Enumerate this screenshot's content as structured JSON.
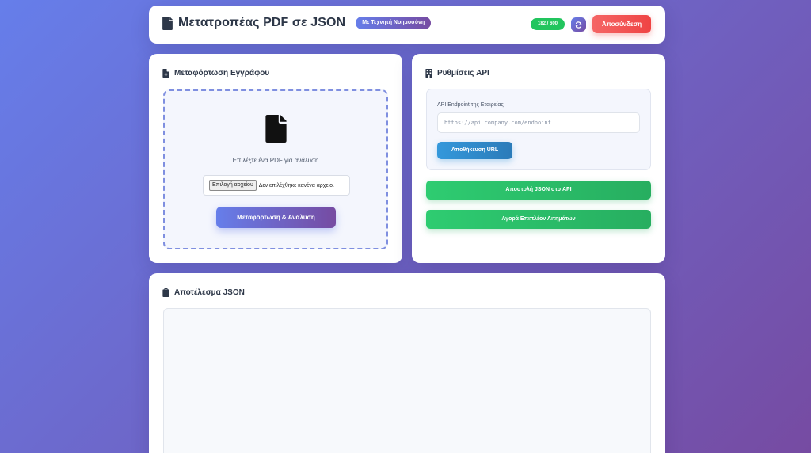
{
  "header": {
    "title": "Μετατροπέας PDF σε JSON",
    "ai_badge": "Με Τεχνητή Νοημοσύνη",
    "usage_counter": "182 / 600",
    "refresh_icon": "refresh-icon",
    "logout_label": "Αποσύνδεση"
  },
  "upload": {
    "section_title": "Μεταφόρτωση Εγγράφου",
    "section_icon": "file-upload-icon",
    "drop_icon": "file-icon",
    "hint": "Επιλέξτε ένα PDF για ανάλυση",
    "file_button_label": "Επιλογή αρχείου",
    "file_status": "Δεν επιλέχθηκε κανένα αρχείο.",
    "submit_label": "Μεταφόρτωση & Ανάλυση"
  },
  "api": {
    "section_title": "Ρυθμίσεις API",
    "section_icon": "building-icon",
    "endpoint_label": "API Endpoint της Εταιρείας",
    "endpoint_placeholder": "https://api.company.com/endpoint",
    "endpoint_value": "",
    "save_url_label": "Αποθήκευση URL",
    "send_json_label": "Αποστολή JSON στο API",
    "buy_requests_label": "Αγορά Επιπλέον Αιτημάτων"
  },
  "result": {
    "section_title": "Αποτέλεσμα JSON",
    "section_icon": "clipboard-icon",
    "content": ""
  },
  "colors": {
    "background_start": "#667eea",
    "background_end": "#764ba2",
    "counter_badge": "#22c55e",
    "logout": "#ef4444",
    "save_url": "#3498db",
    "green_actions": "#27ae60"
  }
}
